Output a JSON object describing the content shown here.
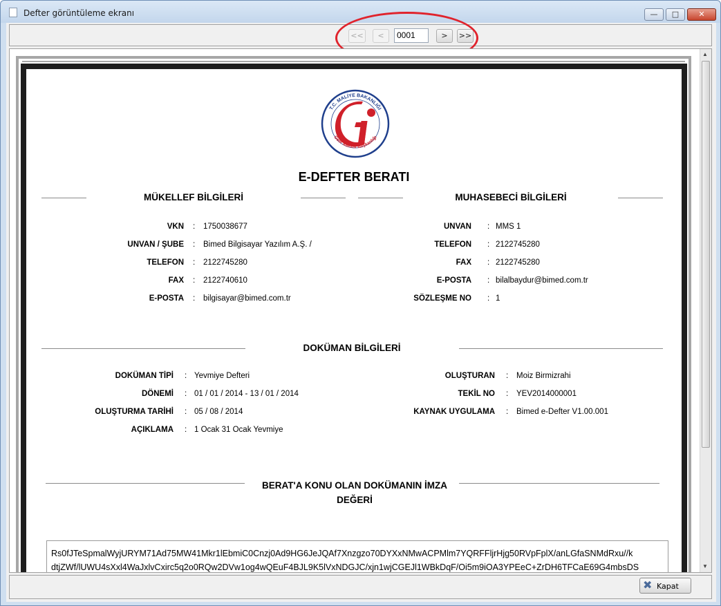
{
  "window": {
    "title": "Defter görüntüleme ekranı"
  },
  "nav": {
    "first": "<<",
    "prev": "<",
    "page": "0001",
    "next": ">",
    "last": ">>"
  },
  "document": {
    "title": "E-DEFTER BERATI",
    "logo_text_top": "T.C. MALİYE BAKANLIĞI",
    "logo_text_bottom": "Gelir İdaresi Başkanlığı",
    "mukellef": {
      "heading": "MÜKELLEF BİLGİLERİ",
      "rows": [
        {
          "label": "VKN",
          "value": "1750038677"
        },
        {
          "label": "UNVAN / ŞUBE",
          "value": "Bimed Bilgisayar Yazılım A.Ş. /"
        },
        {
          "label": "TELEFON",
          "value": "2122745280"
        },
        {
          "label": "FAX",
          "value": "2122740610"
        },
        {
          "label": "E-POSTA",
          "value": "bilgisayar@bimed.com.tr"
        }
      ]
    },
    "muhasebeci": {
      "heading": "MUHASEBECİ BİLGİLERİ",
      "rows": [
        {
          "label": "UNVAN",
          "value": "MMS 1"
        },
        {
          "label": "TELEFON",
          "value": "2122745280"
        },
        {
          "label": "FAX",
          "value": "2122745280"
        },
        {
          "label": "E-POSTA",
          "value": "bilalbaydur@bimed.com.tr"
        },
        {
          "label": "SÖZLEŞME NO",
          "value": "1"
        }
      ]
    },
    "dokuman": {
      "heading": "DOKÜMAN BİLGİLERİ",
      "left_rows": [
        {
          "label": "DOKÜMAN TİPİ",
          "value": "Yevmiye Defteri"
        },
        {
          "label": "DÖNEMİ",
          "value": "01 / 01 / 2014 - 13 / 01 / 2014"
        },
        {
          "label": "OLUŞTURMA TARİHİ",
          "value": "05 / 08 / 2014"
        },
        {
          "label": "AÇIKLAMA",
          "value": "1 Ocak 31 Ocak Yevmiye"
        }
      ],
      "right_rows": [
        {
          "label": "OLUŞTURAN",
          "value": "Moiz Birmizrahi"
        },
        {
          "label": "TEKİL NO",
          "value": "YEV2014000001"
        },
        {
          "label": "KAYNAK UYGULAMA",
          "value": "Bimed e-Defter V1.00.001"
        }
      ]
    },
    "imza": {
      "heading_line1": "BERAT'A KONU OLAN DOKÜMANIN İMZA",
      "heading_line2": "DEĞERİ",
      "lines": [
        "Rs0fJTeSpmalWyjURYM71Ad75MW41Mkr1lEbmiC0Cnzj0Ad9HG6JeJQAf7Xnzgzo70DYXxNMwACPMlm7YQRFFljrHjg50RVpFplX/anLGfaSNMdRxu//k",
        "dtjZWf/lUWU4sXxl4WaJxlvCxirc5q2o0RQw2DVw1og4wQEuF4BJL9K5lVxNDGJC/xjn1wjCGEJl1WBkDqF/Oi5m9iOA3YPEeC+ZrDH6TFCaE69G4mbsDS"
      ]
    }
  },
  "footer": {
    "close_label": "Kapat"
  },
  "colors": {
    "annotation_ellipse": "#e0232c",
    "logo_red": "#d0202a",
    "logo_blue": "#1f3f8c"
  }
}
